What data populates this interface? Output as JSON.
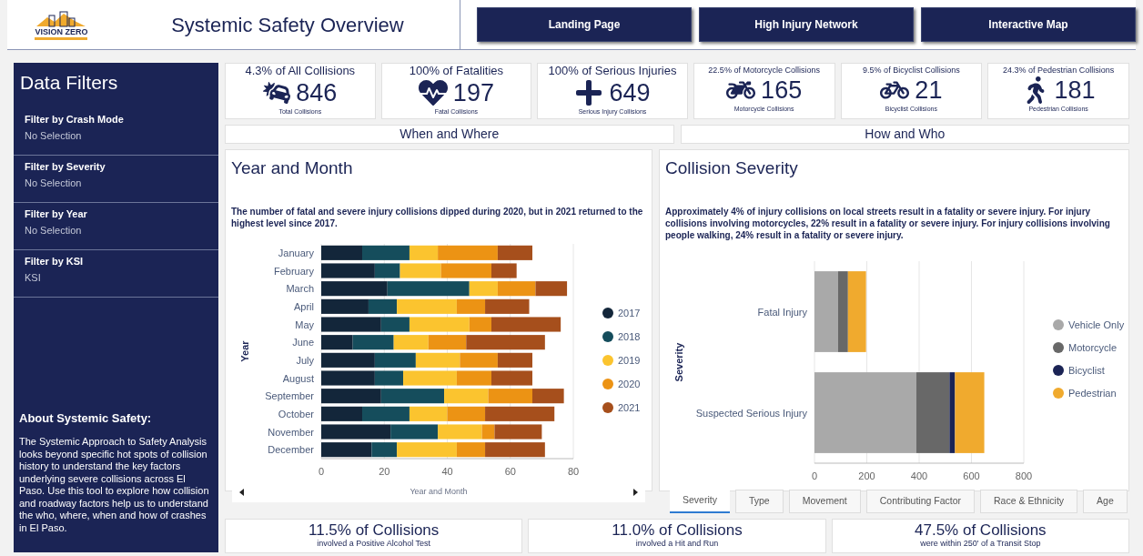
{
  "header": {
    "logo_text": "VISION ZERO",
    "title": "Systemic Safety Overview",
    "nav_buttons": [
      "Landing Page",
      "High Injury Network",
      "Interactive Map"
    ]
  },
  "sidebar": {
    "title": "Data Filters",
    "filters": [
      {
        "label": "Filter by Crash Mode",
        "value": "No Selection"
      },
      {
        "label": "Filter by Severity",
        "value": "No Selection"
      },
      {
        "label": "Filter by Year",
        "value": "No Selection"
      },
      {
        "label": "Filter by KSI",
        "value": "KSI"
      }
    ],
    "about_title": "About Systemic Safety:",
    "about_text": "The Systemic Approach to Safety Analysis looks beyond specific hot spots of collision history to understand the key factors underlying severe collisions across El Paso. Use this tool to explore how collision and roadway factors help us to understand the who, where, when and how of crashes in El Paso."
  },
  "kpis": [
    {
      "kind": "crash",
      "top": "4.3% of All Collisions",
      "value": "846",
      "caption": "Total Collisions"
    },
    {
      "kind": "heart",
      "top": "100% of Fatalities",
      "value": "197",
      "caption": "Fatal Collisions"
    },
    {
      "kind": "cross",
      "top": "100% of Serious Injuries",
      "value": "649",
      "caption": "Serious Injury Collisions"
    },
    {
      "kind": "motorcycle",
      "top": "22.5% of Motorcycle Collisions",
      "value": "165",
      "caption": "Motorcycle Collisions"
    },
    {
      "kind": "bicycle",
      "top": "9.5% of Bicyclist Collisions",
      "value": "21",
      "caption": "Bicyclist Collisions"
    },
    {
      "kind": "walker",
      "top": "24.3% of Pedestrian Collisions",
      "value": "181",
      "caption": "Pedestrian Collisions"
    }
  ],
  "sections": [
    "When and Where",
    "How and Who"
  ],
  "year_panel": {
    "title": "Year and Month",
    "description": "The number of fatal and severe injury collisions dipped during 2020, but in 2021 returned to the highest level since 2017.",
    "chart_data": {
      "type": "bar",
      "orientation": "horizontal",
      "stacked": true,
      "grid": true,
      "legend": true,
      "xlabel": "Year and Month",
      "ylabel": "Year",
      "xlim": [
        0,
        80
      ],
      "xticks": [
        0,
        20,
        40,
        60,
        80
      ],
      "categories": [
        "January",
        "February",
        "March",
        "April",
        "May",
        "June",
        "July",
        "August",
        "September",
        "October",
        "November",
        "December"
      ],
      "series": [
        {
          "name": "2017",
          "color": "#13263a",
          "values": [
            13,
            17,
            21,
            15,
            19,
            10,
            17,
            17,
            19,
            13,
            22,
            16
          ]
        },
        {
          "name": "2018",
          "color": "#154d5c",
          "values": [
            15,
            8,
            26,
            9,
            9,
            13,
            13,
            9,
            20,
            15,
            15,
            8
          ]
        },
        {
          "name": "2019",
          "color": "#fbc42f",
          "values": [
            9,
            13,
            9,
            19,
            19,
            11,
            14,
            17,
            14,
            12,
            14,
            19
          ]
        },
        {
          "name": "2020",
          "color": "#ec9314",
          "values": [
            19,
            16,
            12,
            9,
            7,
            12,
            12,
            11,
            14,
            12,
            4,
            9
          ]
        },
        {
          "name": "2021",
          "color": "#a64f1c",
          "values": [
            11,
            8,
            10,
            14,
            22,
            25,
            11,
            13,
            10,
            22,
            15,
            19
          ]
        }
      ]
    }
  },
  "severity_panel": {
    "title": "Collision Severity",
    "description": "Approximately 4% of injury collisions on local streets result in a fatality or severe injury. For injury collisions involving motorcycles, 22% result in a fatality or severe injury. For injury collisions involving people walking, 24% result in a fatality or severe injury.",
    "chart_data": {
      "type": "bar",
      "orientation": "horizontal",
      "stacked": true,
      "grid": true,
      "legend": true,
      "ylabel": "Severity",
      "xlim": [
        0,
        800
      ],
      "xticks": [
        0,
        200,
        400,
        600,
        800
      ],
      "categories": [
        "Fatal Injury",
        "Suspected Serious Injury"
      ],
      "series": [
        {
          "name": "Vehicle Only",
          "color": "#a9a9a9",
          "values": [
            90,
            389
          ]
        },
        {
          "name": "Motorcycle",
          "color": "#686868",
          "values": [
            38,
            127
          ]
        },
        {
          "name": "Bicyclist",
          "color": "#1b2455",
          "values": [
            0,
            21
          ]
        },
        {
          "name": "Pedestrian",
          "color": "#f0aa2e",
          "values": [
            69,
            112
          ]
        }
      ]
    },
    "tabs": [
      {
        "label": "Severity",
        "selected": true
      },
      {
        "label": "Type",
        "selected": false
      },
      {
        "label": "Movement",
        "selected": false
      },
      {
        "label": "Contributing Factor",
        "selected": false
      },
      {
        "label": "Race & Ethnicity",
        "selected": false
      },
      {
        "label": "Age",
        "selected": false
      }
    ]
  },
  "bottom_stats": [
    {
      "value": "11.5% of Collisions",
      "caption": "involved a Positive Alcohol Test"
    },
    {
      "value": "11.0% of Collisions",
      "caption": "involved a Hit and Run"
    },
    {
      "value": "47.5% of Collisions",
      "caption": "were within 250' of a Transit Stop"
    }
  ]
}
